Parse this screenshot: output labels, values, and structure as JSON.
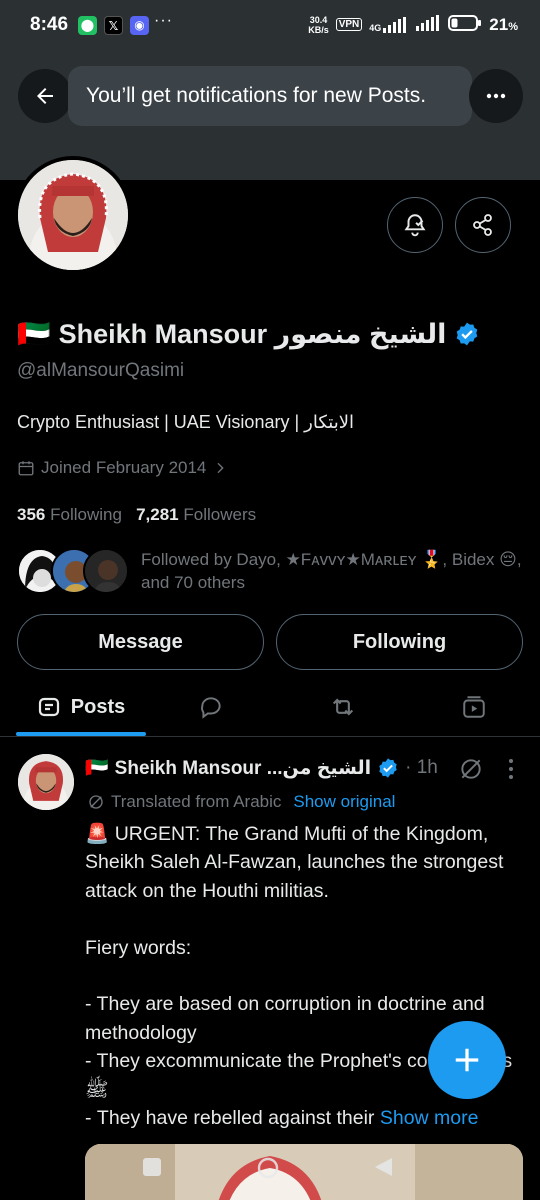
{
  "status_bar": {
    "time": "8:46",
    "overflow": "···",
    "speed_top": "30.4",
    "speed_bottom": "KB/s",
    "vpn": "VPN",
    "network": "4G",
    "battery": "21",
    "battery_unit": "%"
  },
  "banner": {
    "toast": "You’ll get notifications for new Posts."
  },
  "profile": {
    "flag": "🇦🇪",
    "name": "Sheikh Mansour الشيخ منصور",
    "handle": "@alMansourQasimi",
    "bio": "Crypto Enthusiast | UAE Visionary | الابتكار",
    "joined": "Joined February 2014",
    "following_count": "356",
    "following_label": "Following",
    "followers_count": "7,281",
    "followers_label": "Followers",
    "followed_by": "Followed by Dayo, ★Fᴀᴠᴠʏ★Mᴀʀʟᴇʏ 🎖️, Bidex 😔, and 70 others",
    "message_button": "Message",
    "following_button": "Following"
  },
  "tabs": {
    "posts": "Posts"
  },
  "post": {
    "flag": "🇦🇪",
    "name": "Sheikh Mansour ...الشيخ من",
    "time": "· 1h",
    "translated": "Translated from Arabic",
    "show_original": "Show original",
    "text": "🚨 URGENT: The Grand Mufti of the Kingdom, Sheikh Saleh Al-Fawzan, launches the strongest attack on the Houthi militias.\n\nFiery words:\n\n- They are based on corruption in doctrine and methodology\n- They excommunicate the Prophet's companions ﷺ\n- They have rebelled against their ",
    "show_more": "Show more"
  },
  "colors": {
    "accent": "#1d9bf0",
    "muted": "#71767b",
    "border": "#536471",
    "banner_bg": "#2b3033"
  }
}
